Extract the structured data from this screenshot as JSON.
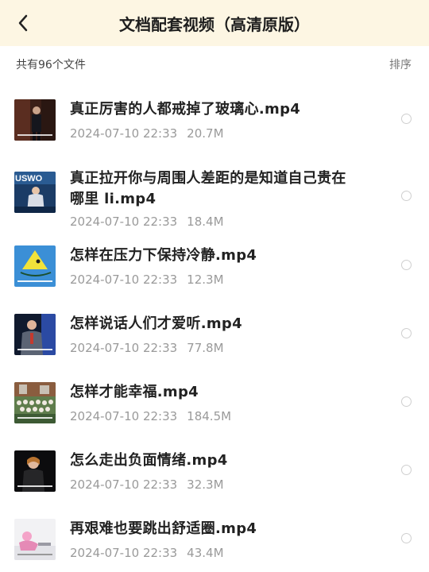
{
  "header": {
    "title": "文档配套视频（高清原版）"
  },
  "toolbar": {
    "count_label": "共有96个文件",
    "sort_label": "排序"
  },
  "files": [
    {
      "name": "真正厉害的人都戒掉了玻璃心.mp4",
      "date": "2024-07-10 22:33",
      "size": "20.7M"
    },
    {
      "name": "真正拉开你与周围人差距的是知道自己贵在哪里 li.mp4",
      "date": "2024-07-10 22:33",
      "size": "18.4M",
      "thumb_text": "USWO"
    },
    {
      "name": "怎样在压力下保持冷静.mp4",
      "date": "2024-07-10 22:33",
      "size": "12.3M"
    },
    {
      "name": "怎样说话人们才爱听.mp4",
      "date": "2024-07-10 22:33",
      "size": "77.8M"
    },
    {
      "name": "怎样才能幸福.mp4",
      "date": "2024-07-10 22:33",
      "size": "184.5M"
    },
    {
      "name": "怎么走出负面情绪.mp4",
      "date": "2024-07-10 22:33",
      "size": "32.3M"
    },
    {
      "name": "再艰难也要跳出舒适圈.mp4",
      "date": "2024-07-10 22:33",
      "size": "43.4M"
    }
  ]
}
